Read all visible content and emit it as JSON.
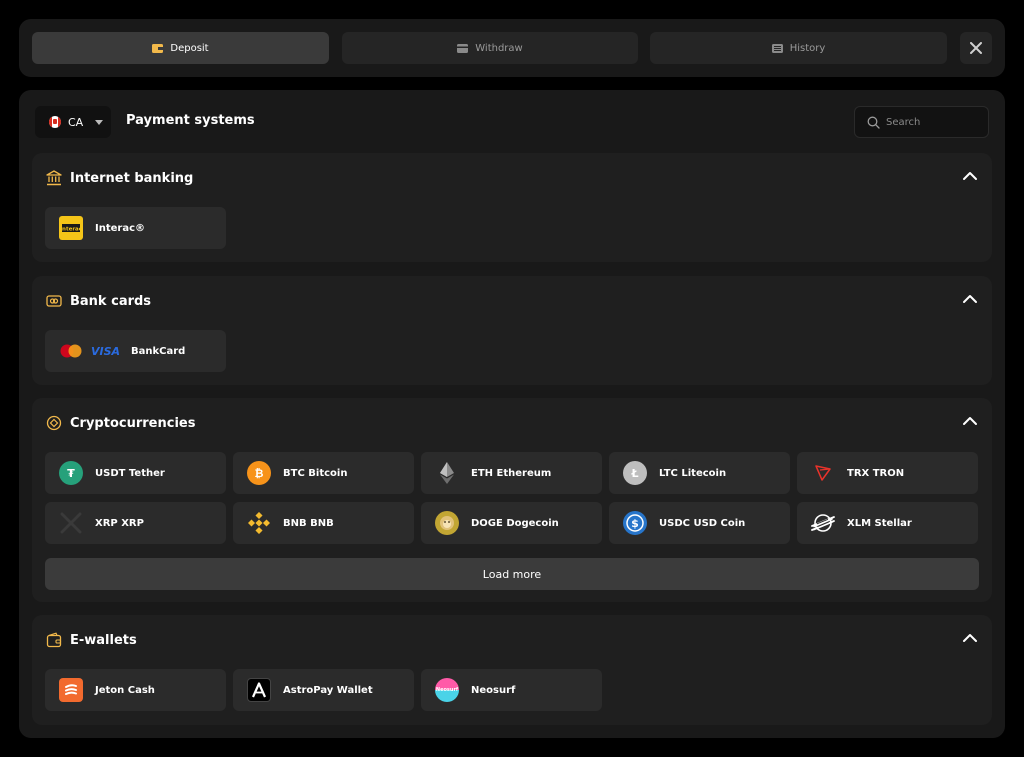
{
  "tabs": [
    {
      "label": "Deposit",
      "active": true
    },
    {
      "label": "Withdraw",
      "active": false
    },
    {
      "label": "History",
      "active": false
    }
  ],
  "header": {
    "country": "CA",
    "title": "Payment systems",
    "search_placeholder": "Search"
  },
  "sections": {
    "internet_banking": {
      "title": "Internet banking",
      "items": [
        {
          "label": "Interac®",
          "icon": "interac-icon"
        }
      ]
    },
    "bank_cards": {
      "title": "Bank cards",
      "items": [
        {
          "label": "BankCard",
          "icon": "mastercard-visa-icon",
          "brand_text": "VISA"
        }
      ]
    },
    "crypto": {
      "title": "Cryptocurrencies",
      "items": [
        {
          "label": "USDT Tether",
          "icon": "tether-icon"
        },
        {
          "label": "BTC Bitcoin",
          "icon": "bitcoin-icon"
        },
        {
          "label": "ETH Ethereum",
          "icon": "ethereum-icon"
        },
        {
          "label": "LTC Litecoin",
          "icon": "litecoin-icon"
        },
        {
          "label": "TRX TRON",
          "icon": "tron-icon"
        },
        {
          "label": "XRP XRP",
          "icon": "xrp-icon"
        },
        {
          "label": "BNB BNB",
          "icon": "bnb-icon"
        },
        {
          "label": "DOGE Dogecoin",
          "icon": "dogecoin-icon"
        },
        {
          "label": "USDC USD Coin",
          "icon": "usdc-icon"
        },
        {
          "label": "XLM Stellar",
          "icon": "stellar-icon"
        }
      ],
      "load_more": "Load more"
    },
    "ewallets": {
      "title": "E-wallets",
      "items": [
        {
          "label": "Jeton Cash",
          "icon": "jeton-icon"
        },
        {
          "label": "AstroPay Wallet",
          "icon": "astropay-icon"
        },
        {
          "label": "Neosurf",
          "icon": "neosurf-icon",
          "brand_text": "Neosurf"
        }
      ]
    }
  },
  "colors": {
    "accent": "#f2b94b",
    "bg": "#000000",
    "panel": "#191919",
    "section": "#1f1f1f",
    "tile": "#2b2b2b"
  }
}
